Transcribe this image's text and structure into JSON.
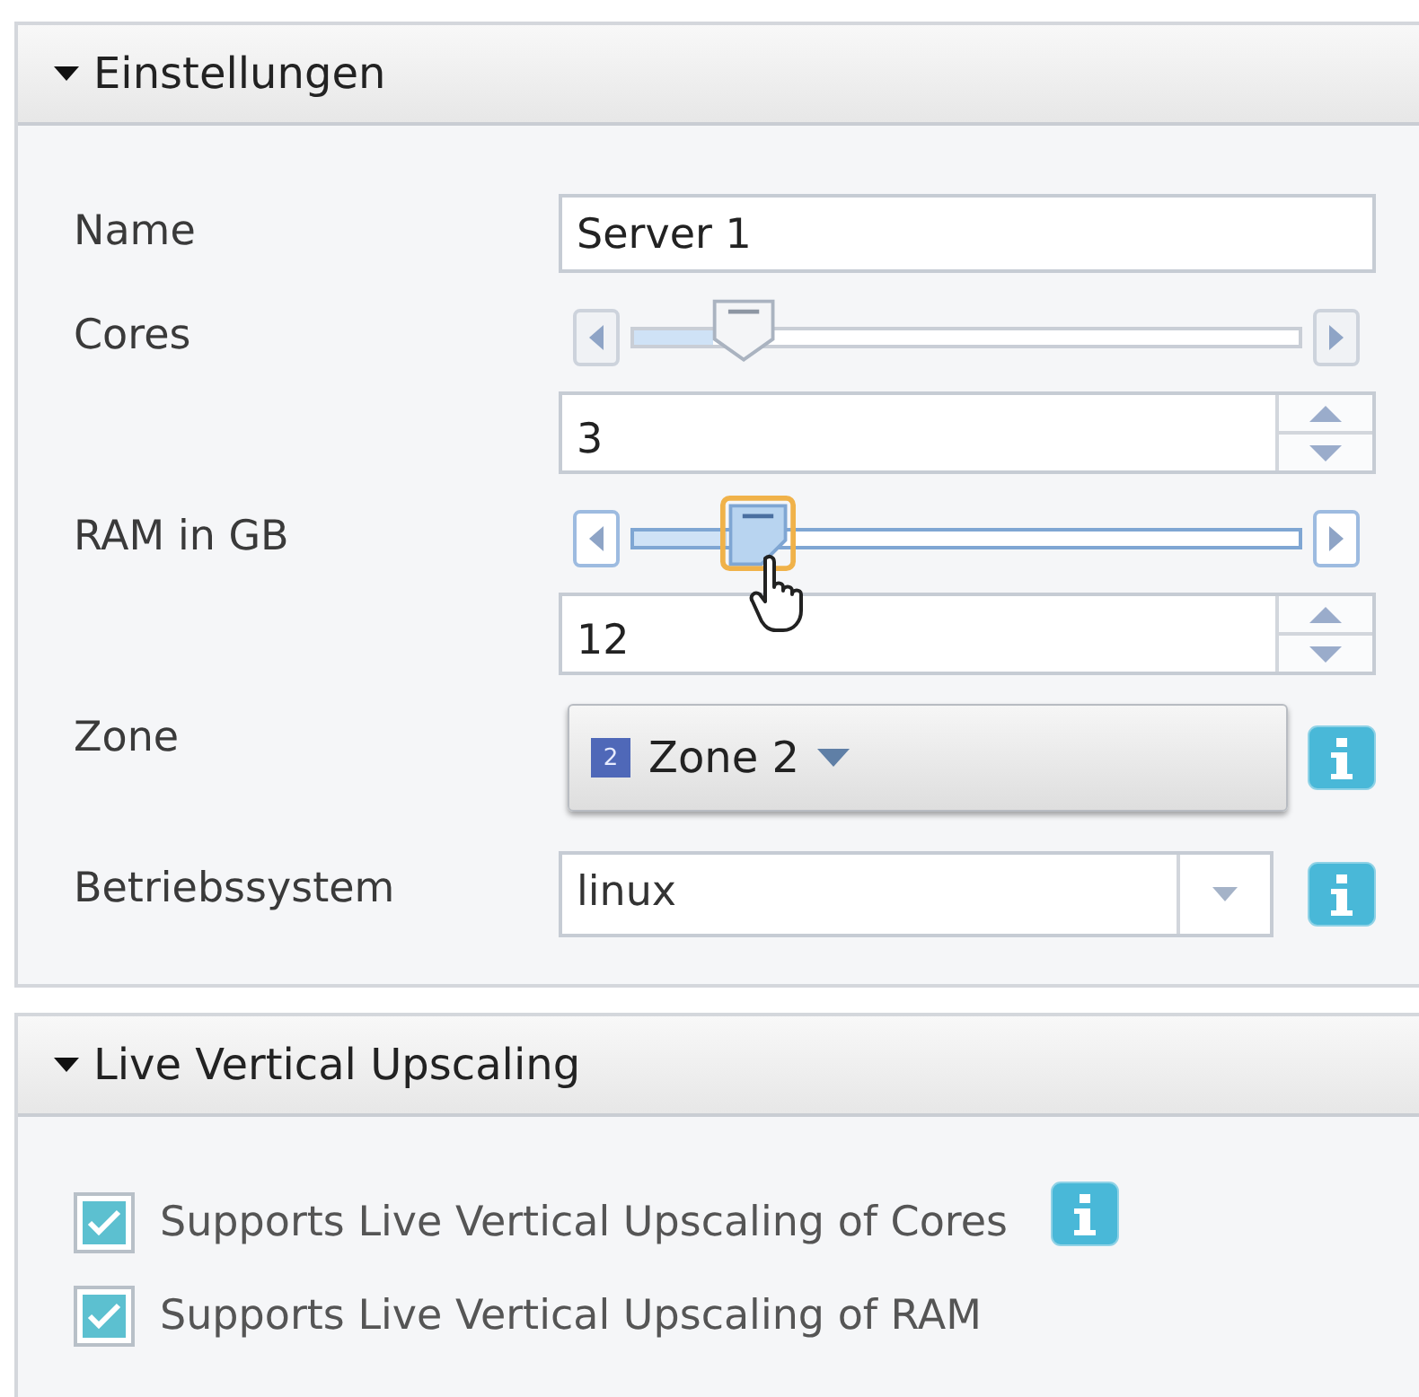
{
  "sections": [
    {
      "title": "Einstellungen",
      "expanded": true,
      "fields": [
        {
          "kind": "text",
          "label": "Name",
          "value": "Server 1"
        },
        {
          "kind": "slider",
          "label": "Cores",
          "level": 0.12,
          "value": "3",
          "focused": false
        },
        {
          "kind": "slider",
          "label": "RAM in GB",
          "level": 0.14,
          "value": "12",
          "focused": true
        },
        {
          "kind": "menu",
          "label": "Zone",
          "badge": "2",
          "value": "Zone 2",
          "info": true
        },
        {
          "kind": "combo",
          "label": "Betriebssystem",
          "value": "linux",
          "info": true
        }
      ]
    },
    {
      "title": "Live Vertical Upscaling",
      "expanded": true,
      "checkboxes": [
        {
          "label": "Supports Live Vertical Upscaling of Cores",
          "checked": true,
          "info": true
        },
        {
          "label": "Supports Live Vertical Upscaling of RAM",
          "checked": true,
          "info": false
        }
      ]
    }
  ]
}
